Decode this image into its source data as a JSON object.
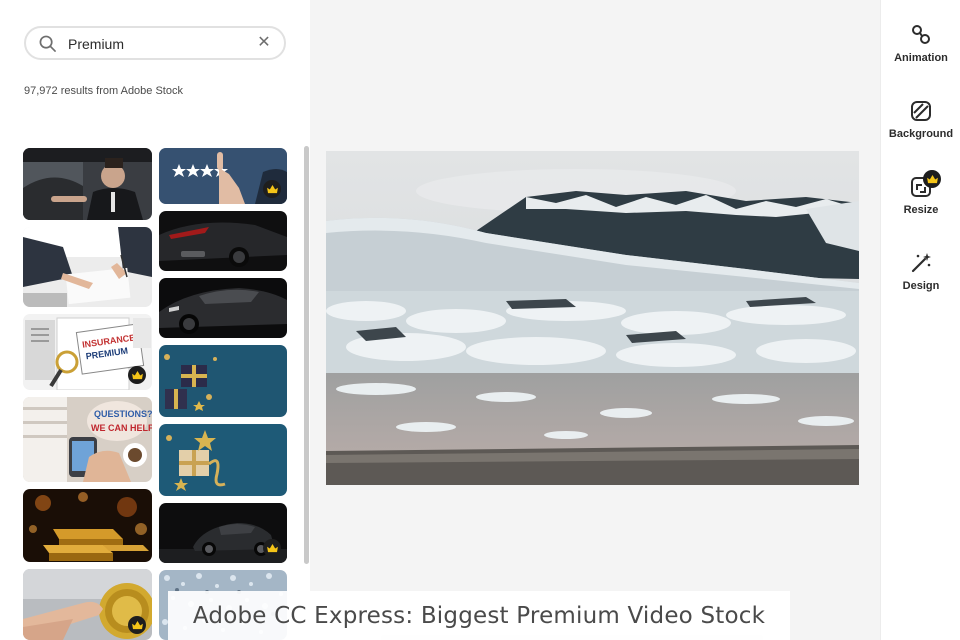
{
  "search": {
    "value": "Premium",
    "placeholder": "Search"
  },
  "results_text": "97,972 results from Adobe Stock",
  "thumbnails": [
    {
      "subject": "man in suit driving car",
      "premium": false
    },
    {
      "subject": "hand touching five star rating",
      "premium": true
    },
    {
      "subject": "business people signing contract",
      "premium": false
    },
    {
      "subject": "dark luxury car rear",
      "premium": false
    },
    {
      "subject": "dark luxury car side",
      "premium": false
    },
    {
      "subject": "insurance premium document with magnifier",
      "premium": true,
      "text": [
        "INSURANCE",
        "PREMIUM"
      ]
    },
    {
      "subject": "gold gift box on blue",
      "premium": false
    },
    {
      "subject": "questions we can help sign",
      "premium": false,
      "text": [
        "QUESTIONS?",
        "WE CAN HELP!"
      ]
    },
    {
      "subject": "gold gift and stars on blue",
      "premium": false
    },
    {
      "subject": "gold bars with bokeh",
      "premium": false
    },
    {
      "subject": "black sports car",
      "premium": true
    },
    {
      "subject": "finger pressing gold coin button",
      "premium": true
    },
    {
      "subject": "silver glitter",
      "premium": false
    }
  ],
  "canvas": {
    "image": "glacier lagoon with icebergs and mountains"
  },
  "rail": {
    "animation": {
      "label": "Animation",
      "icon": "animation-icon"
    },
    "background": {
      "label": "Background",
      "icon": "background-icon"
    },
    "resize": {
      "label": "Resize",
      "icon": "resize-icon",
      "premium": true
    },
    "design": {
      "label": "Design",
      "icon": "design-wand-icon"
    }
  },
  "caption": "Adobe CC Express: Biggest Premium Video Stock",
  "colors": {
    "premium_badge": "#1e1e1e",
    "crown": "#f5c518",
    "canvas_bg": "#f4f4f4"
  }
}
